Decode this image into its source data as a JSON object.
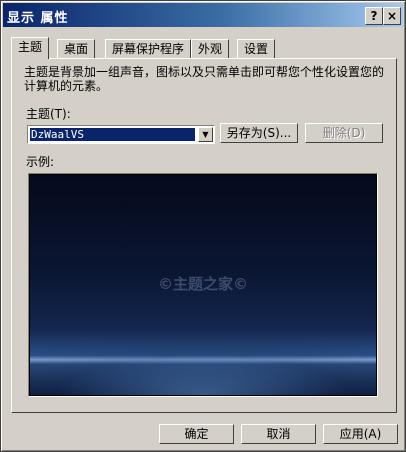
{
  "window": {
    "title": "显示 属性"
  },
  "titlebar_buttons": {
    "help": "?",
    "close": "×"
  },
  "tabs": [
    {
      "label": "主题"
    },
    {
      "label": "桌面"
    },
    {
      "label": "屏幕保护程序"
    },
    {
      "label": "外观"
    },
    {
      "label": "设置"
    }
  ],
  "panel": {
    "description": "主题是背景加一组声音，图标以及只需单击即可帮您个性化设置您的计算机的元素。",
    "theme_label": "主题(T):",
    "theme_value": "DzWaalVS",
    "save_as_label": "另存为(S)...",
    "delete_label": "删除(D)",
    "sample_label": "示例:",
    "preview_watermark": "©主题之家©"
  },
  "footer": {
    "ok_label": "确定",
    "cancel_label": "取消",
    "apply_label": "应用(A)"
  },
  "colors": {
    "titlebar_start": "#0a246a",
    "face": "#d4d0c8",
    "selection": "#0a246a"
  }
}
